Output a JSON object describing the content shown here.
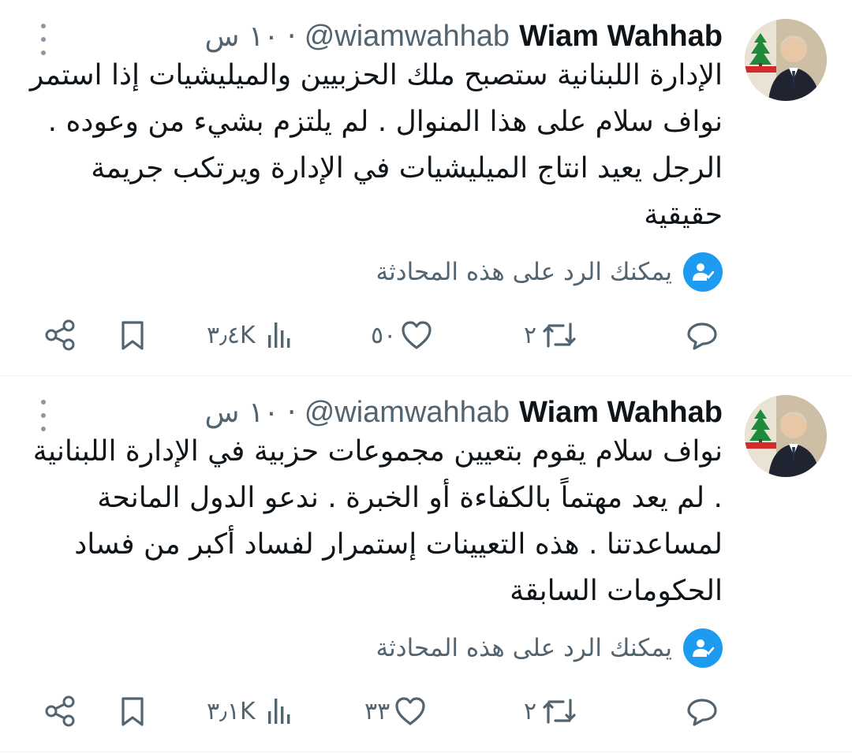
{
  "tweets": [
    {
      "author_name": "Wiam Wahhab",
      "handle": "@wiamwahhab",
      "separator": "·",
      "time": "١٠ س",
      "text": "الإدارة اللبنانية ستصبح ملك الحزبيين والميليشيات إذا استمر نواف سلام على هذا المنوال . لم يلتزم بشيء من وعوده . الرجل يعيد انتاج الميليشيات في الإدارة ويرتكب جريمة حقيقية",
      "reply_notice": "يمكنك الرد على هذه المحادثة",
      "retweets": "٢",
      "likes": "٥٠",
      "views": "٣٫٤K"
    },
    {
      "author_name": "Wiam Wahhab",
      "handle": "@wiamwahhab",
      "separator": "·",
      "time": "١٠ س",
      "text": "نواف سلام يقوم بتعيين مجموعات حزبية في الإدارة اللبنانية . لم يعد مهتماً بالكفاءة أو الخبرة . ندعو الدول المانحة لمساعدتنا . هذه التعيينات إستمرار لفساد أكبر من فساد الحكومات السابقة",
      "reply_notice": "يمكنك الرد على هذه المحادثة",
      "retweets": "٢",
      "likes": "٣٣",
      "views": "٣٫١K"
    }
  ],
  "icons": {
    "more": "more-vertical-icon",
    "reply": "reply-icon",
    "retweet": "retweet-icon",
    "like": "heart-icon",
    "views": "views-icon",
    "bookmark": "bookmark-icon",
    "share": "share-icon",
    "notice": "person-check-icon"
  },
  "colors": {
    "text": "#0f1419",
    "secondary": "#536471",
    "accent": "#1d9bf0"
  }
}
